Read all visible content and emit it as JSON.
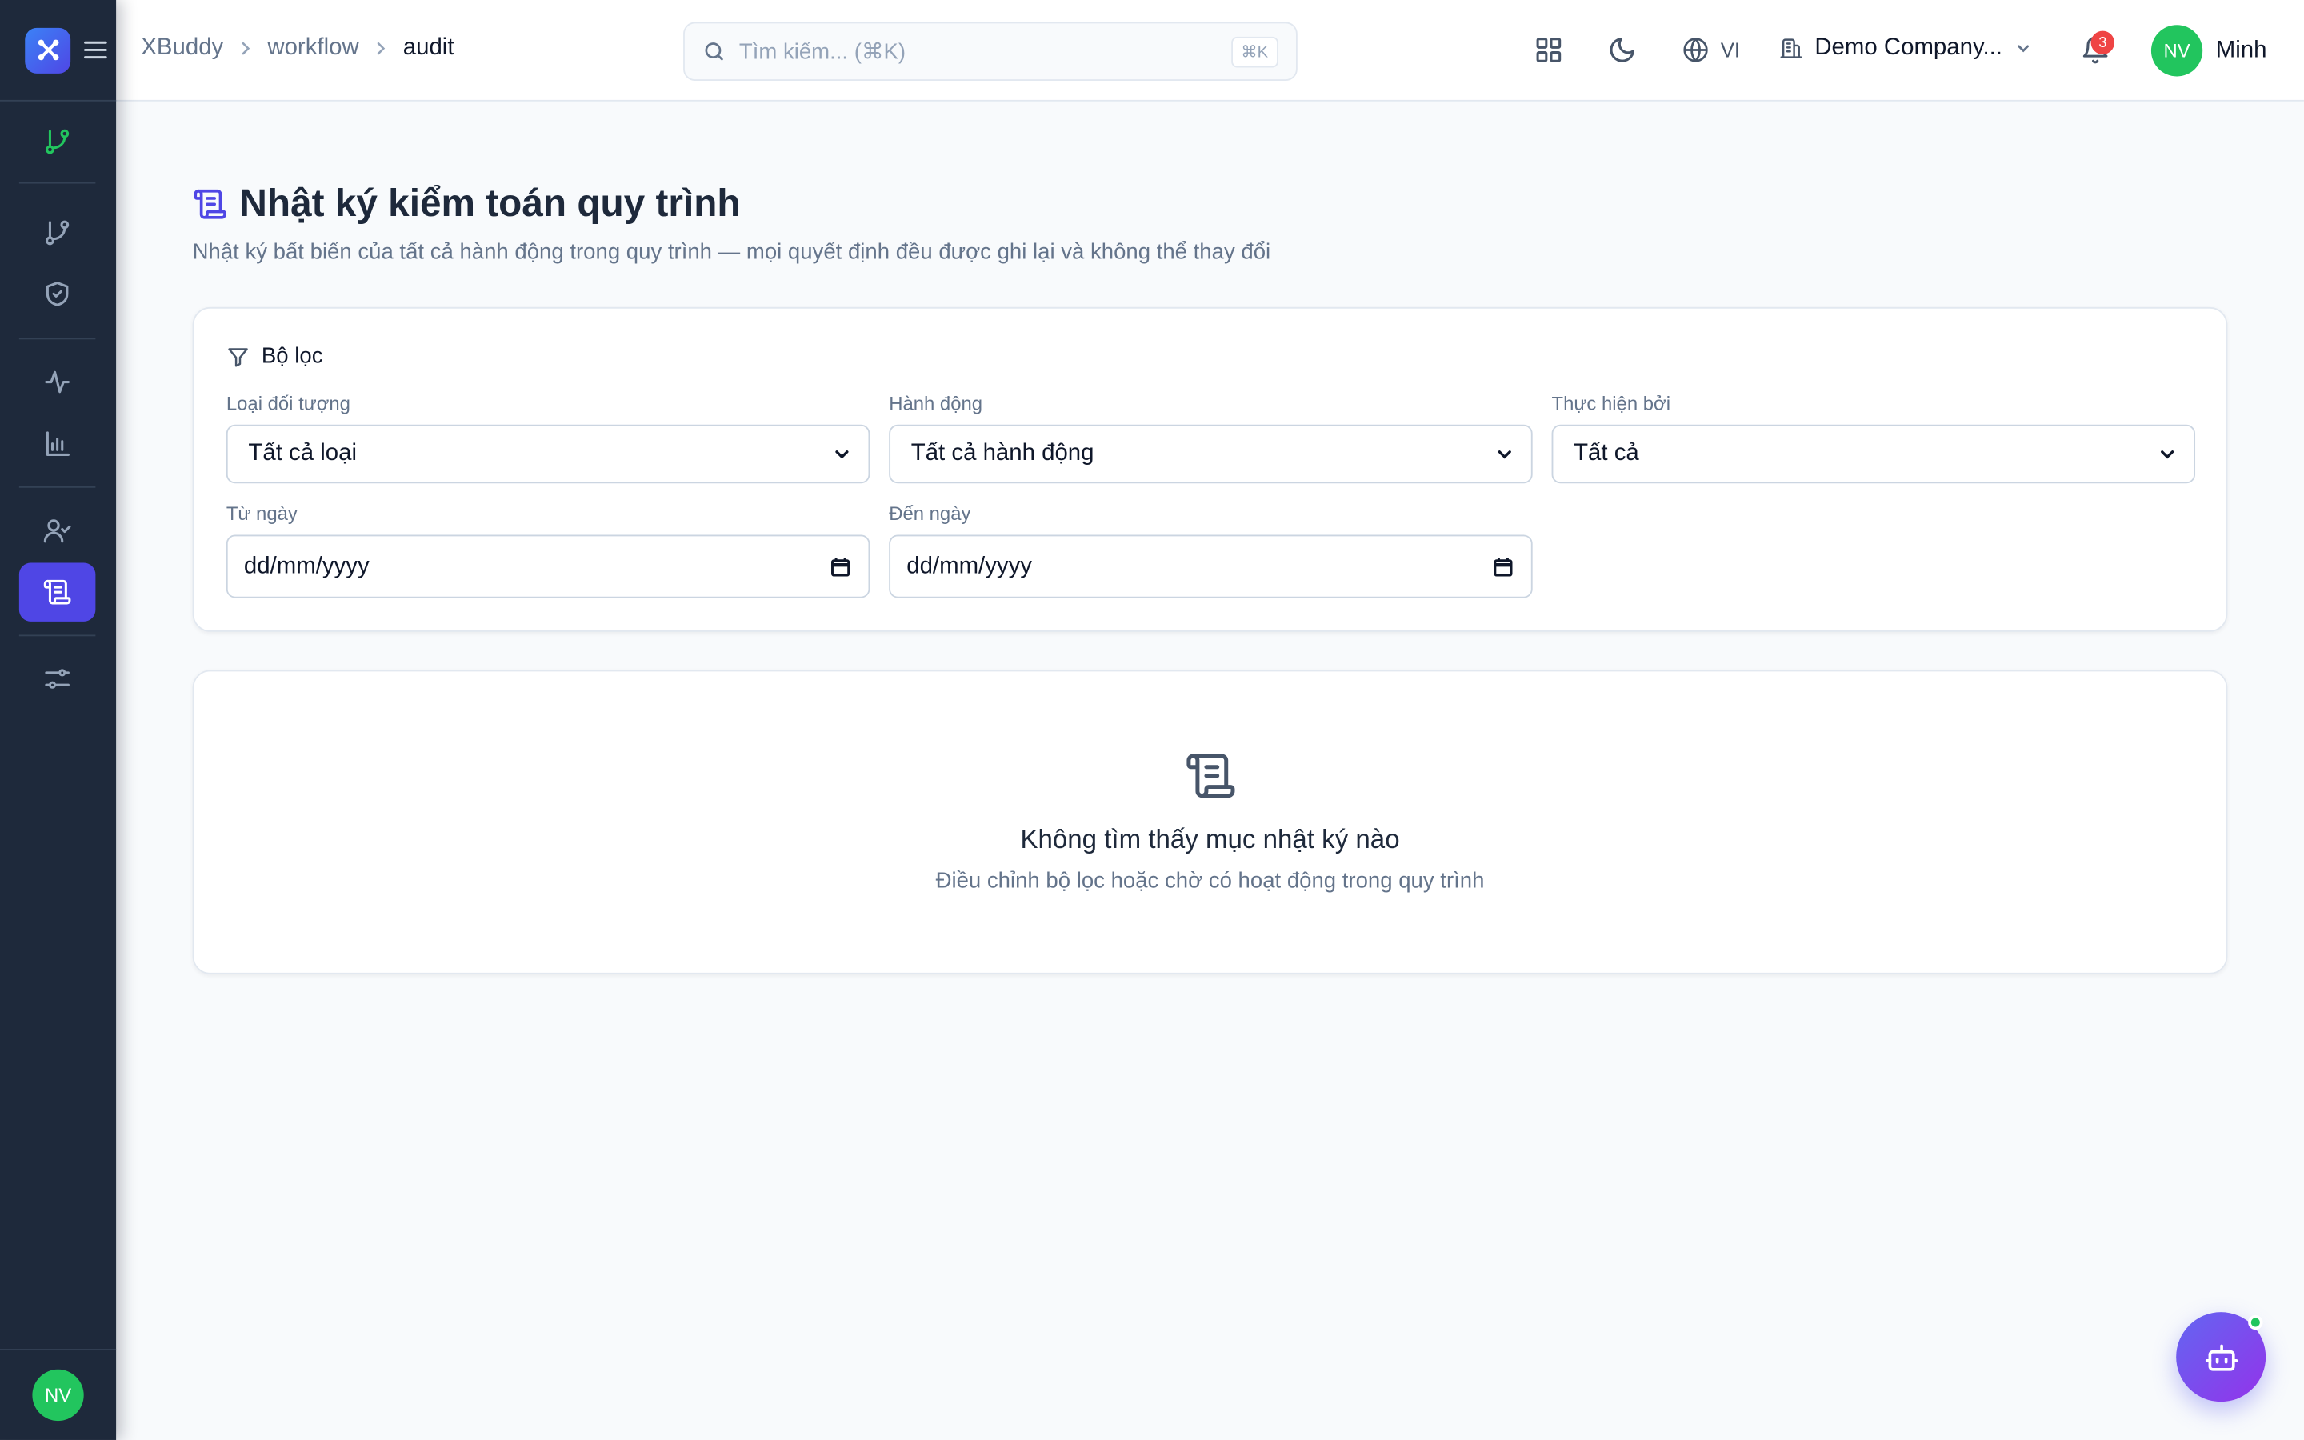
{
  "app": {
    "logo_icon": "app-logo-icon",
    "menu_icon": "hamburger-icon"
  },
  "sidebar": {
    "items": [
      {
        "icon": "git-branch-icon",
        "active": false,
        "color": "#22c55e"
      },
      {
        "icon": "git-branch-icon",
        "active": false
      },
      {
        "icon": "shield-check-icon",
        "active": false
      },
      {
        "icon": "activity-icon",
        "active": false
      },
      {
        "icon": "bar-chart-icon",
        "active": false
      },
      {
        "icon": "user-check-icon",
        "active": false
      },
      {
        "icon": "scroll-icon",
        "active": true
      },
      {
        "icon": "sliders-icon",
        "active": false
      }
    ],
    "user_initials": "NV"
  },
  "header": {
    "breadcrumb": [
      "XBuddy",
      "workflow",
      "audit"
    ],
    "search": {
      "placeholder": "Tìm kiếm... (⌘K)",
      "shortcut": "⌘K"
    },
    "language": "VI",
    "company": "Demo Company...",
    "notifications_count": "3",
    "user": {
      "initials": "NV",
      "name": "Minh"
    }
  },
  "page": {
    "title": "Nhật ký kiểm toán quy trình",
    "subtitle": "Nhật ký bất biến của tất cả hành động trong quy trình — mọi quyết định đều được ghi lại và không thể thay đổi"
  },
  "filters": {
    "heading": "Bộ lọc",
    "object_type": {
      "label": "Loại đối tượng",
      "value": "Tất cả loại"
    },
    "action": {
      "label": "Hành động",
      "value": "Tất cả hành động"
    },
    "performed_by": {
      "label": "Thực hiện bởi",
      "value": "Tất cả"
    },
    "from_date": {
      "label": "Từ ngày",
      "value": "dd/mm/yyyy"
    },
    "to_date": {
      "label": "Đến ngày",
      "value": "dd/mm/yyyy"
    }
  },
  "empty_state": {
    "title": "Không tìm thấy mục nhật ký nào",
    "subtitle": "Điều chỉnh bộ lọc hoặc chờ có hoạt động trong quy trình"
  },
  "colors": {
    "accent": "#4f46e5",
    "sidebar_bg": "#1e293b",
    "success": "#22c55e",
    "danger": "#ef4444"
  }
}
